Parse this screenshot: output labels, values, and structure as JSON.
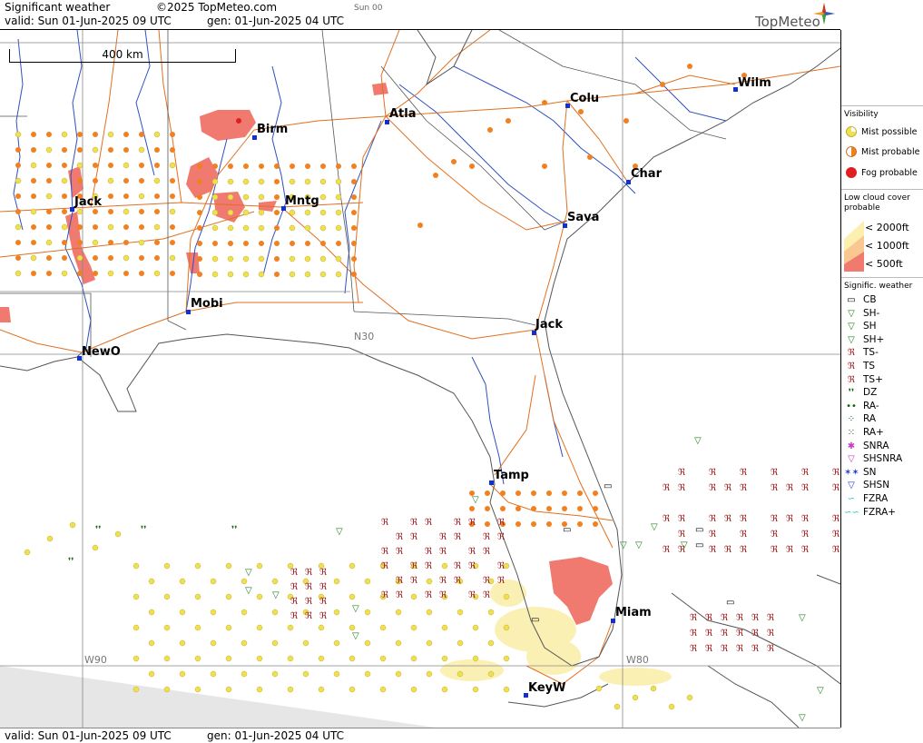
{
  "header": {
    "title": "Significant weather",
    "copyright": "©2025 TopMeteo.com",
    "day_tag": "Sun 00",
    "valid": "valid:  Sun  01-Jun-2025  09 UTC",
    "gen": "gen: 01-Jun-2025 04 UTC",
    "brand": "TopMeteo"
  },
  "footer": {
    "valid": "valid:  Sun  01-Jun-2025  09 UTC",
    "gen": "gen: 01-Jun-2025 04 UTC"
  },
  "map": {
    "scale_label": "400 km",
    "cities": [
      {
        "name": "Birm"
      },
      {
        "name": "Atla"
      },
      {
        "name": "Colu"
      },
      {
        "name": "Wilm"
      },
      {
        "name": "Char"
      },
      {
        "name": "Jack"
      },
      {
        "name": "Mntg"
      },
      {
        "name": "Sava"
      },
      {
        "name": "Mobi"
      },
      {
        "name": "Jack"
      },
      {
        "name": "NewO"
      },
      {
        "name": "Tamp"
      },
      {
        "name": "Miam"
      },
      {
        "name": "KeyW"
      }
    ],
    "grid_labels": {
      "lat30": "N30",
      "lon90": "W90",
      "lon80": "W80"
    }
  },
  "legend": {
    "visibility_title": "Visibility",
    "visibility": [
      {
        "label": "Mist possible",
        "color": "#f0e050"
      },
      {
        "label": "Mist probable",
        "color": "#f08020"
      },
      {
        "label": "Fog probable",
        "color": "#e02020"
      }
    ],
    "cloud_title": "Low cloud cover probable",
    "cloud": [
      {
        "label": "< 2000ft",
        "color": "#fbf0b0"
      },
      {
        "label": "< 1000ft",
        "color": "#f8c890"
      },
      {
        "label": "<   500ft",
        "color": "#f07a70"
      }
    ],
    "weather_title": "Signific. weather",
    "weather": [
      {
        "label": "CB",
        "icon": "cb-box",
        "color": "#000000"
      },
      {
        "label": "SH-",
        "icon": "shower-light",
        "color": "#208020"
      },
      {
        "label": "SH",
        "icon": "shower",
        "color": "#208020"
      },
      {
        "label": "SH+",
        "icon": "shower-heavy",
        "color": "#208020"
      },
      {
        "label": "TS-",
        "icon": "thunder-light",
        "color": "#a02020"
      },
      {
        "label": "TS",
        "icon": "thunder",
        "color": "#a02020"
      },
      {
        "label": "TS+",
        "icon": "thunder-heavy",
        "color": "#a02020"
      },
      {
        "label": "DZ",
        "icon": "drizzle",
        "color": "#106010"
      },
      {
        "label": "RA-",
        "icon": "rain-light",
        "color": "#106010"
      },
      {
        "label": "RA",
        "icon": "rain",
        "color": "#106010"
      },
      {
        "label": "RA+",
        "icon": "rain-heavy",
        "color": "#106010"
      },
      {
        "label": "SNRA",
        "icon": "sleet",
        "color": "#c040c0"
      },
      {
        "label": "SHSNRA",
        "icon": "sleet-shower",
        "color": "#c040c0"
      },
      {
        "label": "SN",
        "icon": "snow",
        "color": "#2040d0"
      },
      {
        "label": "SHSN",
        "icon": "snow-shower",
        "color": "#2040d0"
      },
      {
        "label": "FZRA",
        "icon": "freezing-rain",
        "color": "#20c0d0"
      },
      {
        "label": "FZRA+",
        "icon": "freezing-rain-heavy",
        "color": "#20c0d0"
      }
    ]
  }
}
